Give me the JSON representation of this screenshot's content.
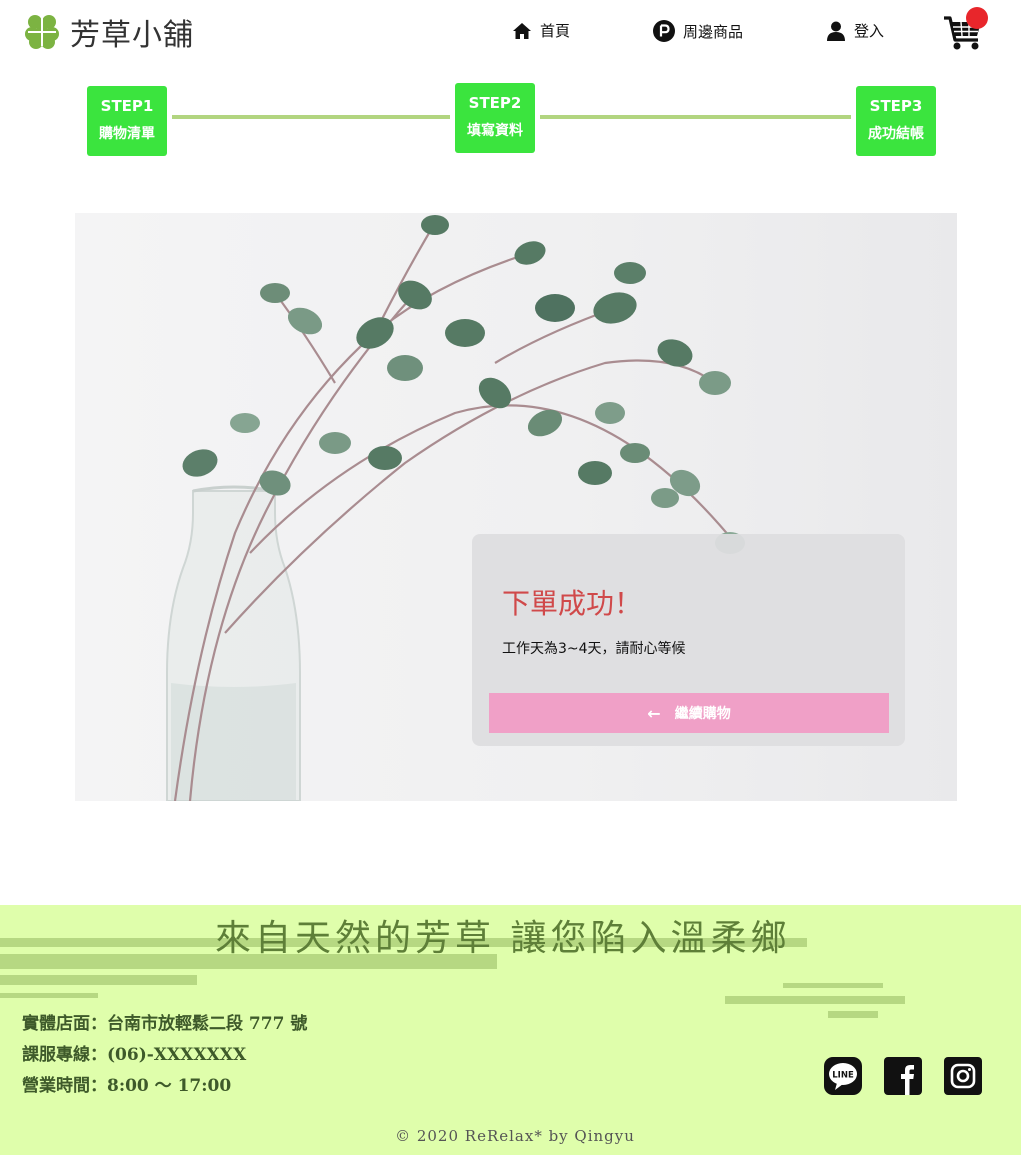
{
  "header": {
    "logo_text": "芳草小舖",
    "nav": [
      {
        "label": "首頁",
        "icon": "home-icon"
      },
      {
        "label": "周邊商品",
        "icon": "parking-p-icon"
      },
      {
        "label": "登入",
        "icon": "user-icon"
      }
    ],
    "cart_icon": "cart-icon"
  },
  "steps": [
    {
      "title": "STEP1",
      "label": "購物清單"
    },
    {
      "title": "STEP2",
      "label": "填寫資料"
    },
    {
      "title": "STEP3",
      "label": "成功結帳"
    }
  ],
  "success_card": {
    "title": "下單成功！",
    "message": "工作天為3~4天，請耐心等候",
    "button_arrow": "←",
    "button_label": "繼續購物"
  },
  "footer": {
    "slogan": "來自天然的芳草 讓您陷入溫柔鄉",
    "address": "實體店面：台南市放輕鬆二段 777 號",
    "phone": "課服專線：(06)-XXXXXXX",
    "hours": "營業時間：8:00 ～ 17:00",
    "social": [
      "line-icon",
      "facebook-icon",
      "instagram-icon"
    ],
    "copyright": "© 2020 ReRelax* by Qingyu"
  },
  "colors": {
    "step_green": "#3be43e",
    "step_line": "#b2d580",
    "footer_bg": "#dffeab",
    "button_pink": "#f0a0c7",
    "success_red": "#d0494a",
    "cart_badge": "#e8262b"
  }
}
